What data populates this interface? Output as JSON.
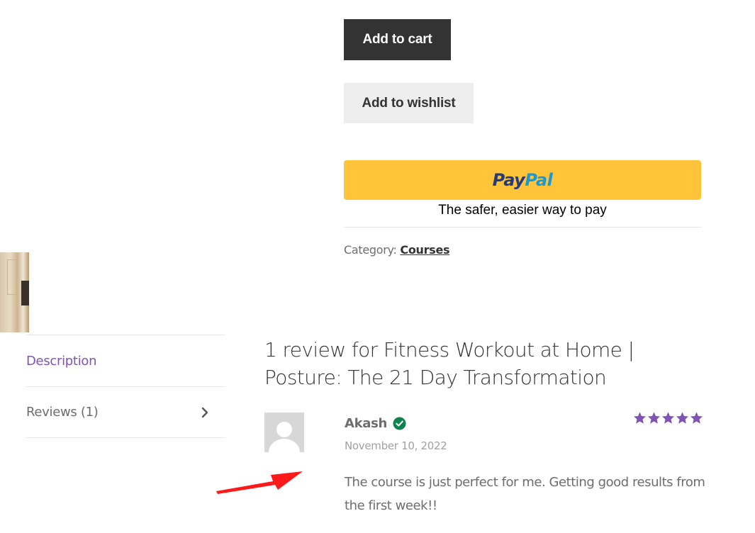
{
  "product": {
    "add_to_cart_label": "Add to cart",
    "add_to_wishlist_label": "Add to wishlist",
    "paypal": {
      "logo_pay": "Pay",
      "logo_pal": "Pal",
      "tagline": "The safer, easier way to pay",
      "button_color": "#ffc439"
    },
    "category_label": "Category:",
    "category_link": "Courses"
  },
  "tabs": [
    {
      "label": "Description",
      "active": true,
      "color": "#7f54b3"
    },
    {
      "label": "Reviews (1)",
      "active": false,
      "icon": "chevron-right-icon"
    }
  ],
  "reviews": {
    "title": "1 review for Fitness Workout at Home | Posture: The 21 Day Transformation",
    "items": [
      {
        "author": "Akash",
        "verified_icon": "verified-check-icon",
        "date": "November 10, 2022",
        "rating": 5,
        "star_color": "#7f54b3",
        "text": "The course is just perfect for me. Getting good results from the first week!!"
      }
    ]
  },
  "annotation": {
    "icon": "red-arrow-icon",
    "color": "#ff0000"
  }
}
